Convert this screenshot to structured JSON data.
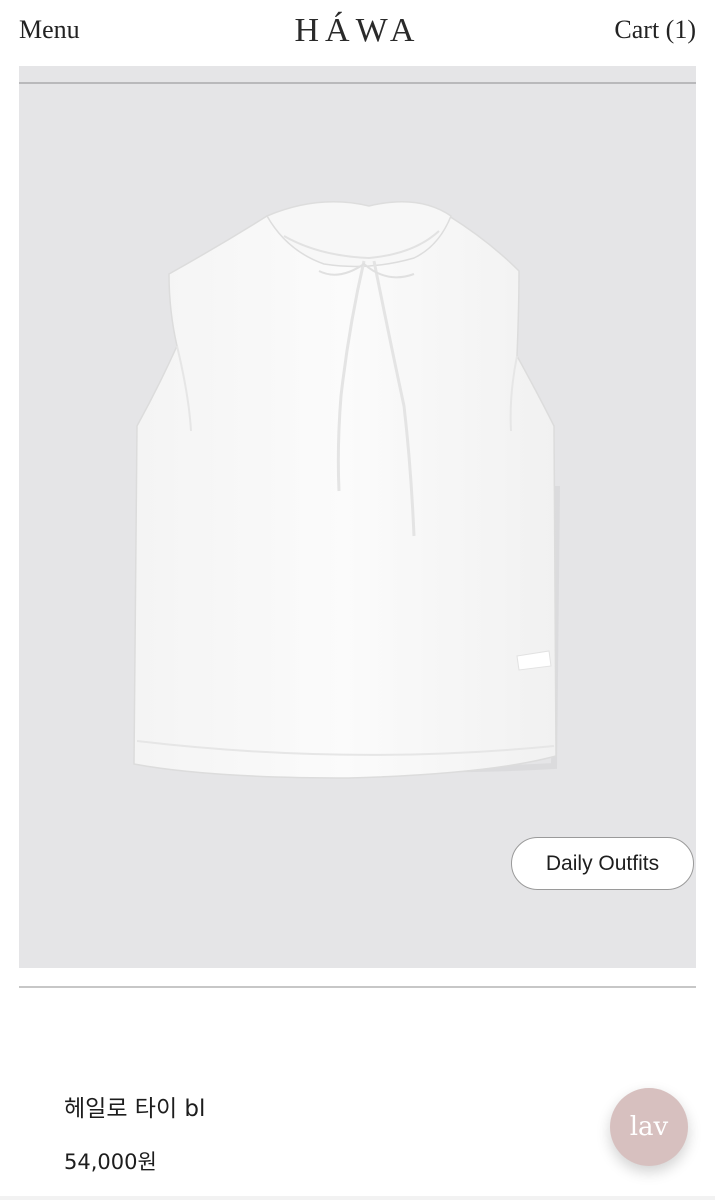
{
  "header": {
    "menu_label": "Menu",
    "brand": "HÁWA",
    "cart_label": "Cart (1)"
  },
  "product": {
    "image_icon": "sleeveless-white-blouse-photo",
    "tag": "Daily Outfits",
    "name": "헤일로 타이 bl",
    "price": "54,000원"
  },
  "floating_button": {
    "label": "lav",
    "icon": "chat-widget-icon"
  },
  "colors": {
    "image_background": "#e5e5e7",
    "floating_button": "#d7c0bf",
    "text": "#222222"
  }
}
